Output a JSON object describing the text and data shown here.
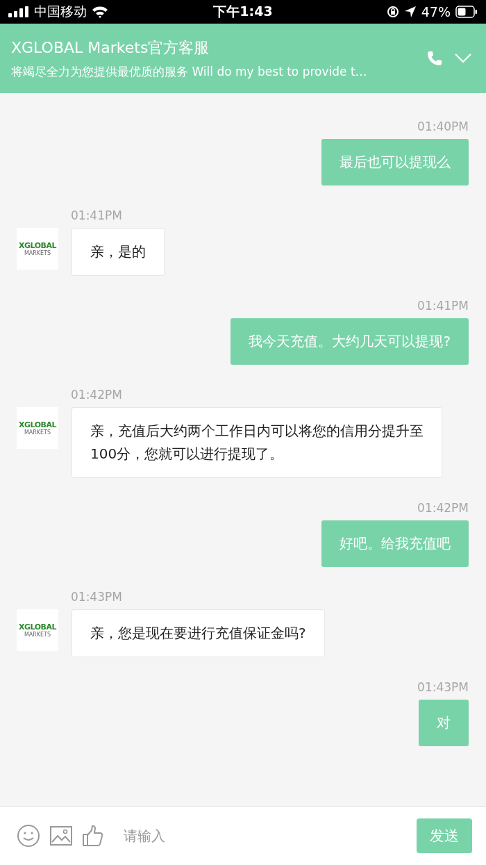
{
  "status_bar": {
    "carrier": "中国移动",
    "time": "下午1:43",
    "battery": "47%"
  },
  "header": {
    "title": "XGLOBAL Markets官方客服",
    "subtitle": "将竭尽全力为您提供最优质的服务 Will do my best to provide t…"
  },
  "messages": [
    {
      "kind": "outgoing",
      "time": "01:40PM",
      "text": "最后也可以提现么"
    },
    {
      "kind": "incoming",
      "time": "01:41PM",
      "text": "亲，是的",
      "avatar": {
        "name": "XGLOBAL",
        "sub": "MARKETS"
      }
    },
    {
      "kind": "outgoing",
      "time": "01:41PM",
      "text": "我今天充值。大约几天可以提现?"
    },
    {
      "kind": "incoming",
      "time": "01:42PM",
      "text": "亲，充值后大约两个工作日内可以将您的信用分提升至100分，您就可以进行提现了。",
      "avatar": {
        "name": "XGLOBAL",
        "sub": "MARKETS"
      }
    },
    {
      "kind": "outgoing",
      "time": "01:42PM",
      "text": "好吧。给我充值吧"
    },
    {
      "kind": "incoming",
      "time": "01:43PM",
      "text": "亲，您是现在要进行充值保证金吗?",
      "avatar": {
        "name": "XGLOBAL",
        "sub": "MARKETS"
      }
    },
    {
      "kind": "outgoing",
      "time": "01:43PM",
      "text": "对"
    }
  ],
  "composer": {
    "placeholder": "请输入",
    "send": "发送"
  }
}
